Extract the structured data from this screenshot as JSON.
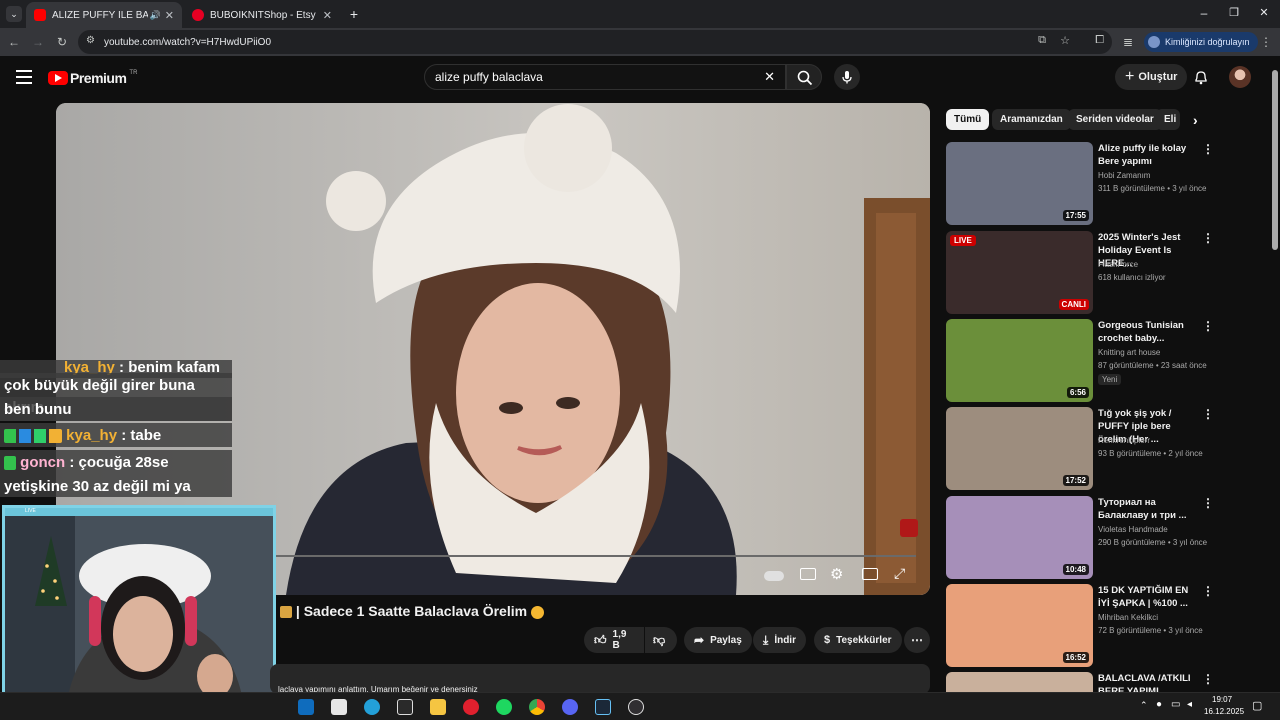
{
  "tabs": [
    {
      "title": "ALİZE PUFFY İLE BALACLAVA",
      "active": true
    },
    {
      "title": "BUBOIKNITShop - Etsy",
      "active": false
    }
  ],
  "browser": {
    "url": "youtube.com/watch?v=H7HwdUPiiO0",
    "profile_label": "Kimliğinizi doğrulayın"
  },
  "yt": {
    "logo_text": "Premium",
    "logo_sup": "TR",
    "search_value": "alize puffy balaclava",
    "create_label": "Oluştur"
  },
  "video": {
    "title_visible": "| Sadece 1 Saatte Balaclava Örelim",
    "like_count": "1,9 B",
    "share_label": "Paylaş",
    "download_label": "İndir",
    "thanks_label": "Teşekkürler",
    "description_snippet": "laclava yapımını anlattım. Umarım beğenir ve denersiniz"
  },
  "chat": [
    {
      "user": "kya_hy",
      "text": ": benim kafam",
      "partial": true
    },
    {
      "text": "çok büyük değil girer buna alırım"
    },
    {
      "text": "ben bunu"
    },
    {
      "user": "kya_hy",
      "text": ": tabe"
    },
    {
      "user": "goncn",
      "text": ": çocuğa 28se"
    },
    {
      "text": "yetişkine 30 az değil mi ya"
    }
  ],
  "filters": [
    "Tümü",
    "Aramanızdan",
    "Seriden videolar",
    "Eli"
  ],
  "recommendations": [
    {
      "title": "Alize puffy ile kolay Bere yapımı",
      "channel": "Hobi Zamanım",
      "meta": "311 B görüntüleme • 3 yıl önce",
      "duration": "17:55",
      "thumb_color": "#6a6f80"
    },
    {
      "title": "2025 Winter's Jest Holiday Event Is HERE...",
      "channel": "FlashForce",
      "meta": "618 kullanıcı izliyor",
      "duration": "CANLI",
      "live_badge": "LIVE",
      "thumb_color": "#3a2b2b"
    },
    {
      "title": "Gorgeous Tunisian crochet baby...",
      "channel": "Knitting art house",
      "meta": "87 görüntüleme • 23 saat önce",
      "badge": "Yeni",
      "duration": "6:56",
      "thumb_color": "#6b8f3a"
    },
    {
      "title": "Tığ yok şiş yok / PUFFY iple bere örelim (Her ...",
      "channel": "Renkrenkiplerr",
      "meta": "93 B görüntüleme • 2 yıl önce",
      "duration": "17:52",
      "thumb_color": "#9d8d7e"
    },
    {
      "title": "Туториал на Балаклаву и три ...",
      "channel": "Violetas Handmade",
      "meta": "290 B görüntüleme • 3 yıl önce",
      "duration": "10:48",
      "thumb_color": "#a68fb9"
    },
    {
      "title": "15 DK YAPTIĞIM EN İYİ ŞAPKA | %100 ...",
      "channel": "Mihriban Kekilkci",
      "meta": "72 B görüntüleme • 3 yıl önce",
      "duration": "16:52",
      "thumb_color": "#e8a07a"
    },
    {
      "title": "BALACLAVA /ATKILI BERE YAPIMI",
      "channel": "",
      "meta": "",
      "duration": "",
      "thumb_color": "#c9b09c"
    }
  ],
  "taskbar": {
    "time": "19:07",
    "date": "16.12.2025"
  },
  "overlay": {
    "webcam_label": "LIVE"
  }
}
